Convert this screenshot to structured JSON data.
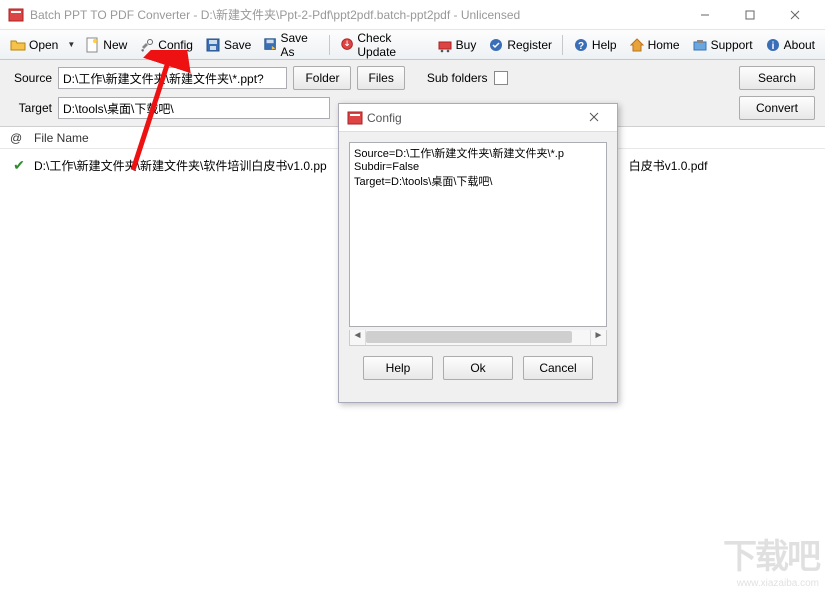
{
  "window": {
    "title": "Batch PPT TO PDF Converter - D:\\新建文件夹\\Ppt-2-Pdf\\ppt2pdf.batch-ppt2pdf - Unlicensed"
  },
  "toolbar": {
    "open": "Open",
    "new": "New",
    "config": "Config",
    "save": "Save",
    "save_as": "Save As",
    "check_update": "Check Update",
    "buy": "Buy",
    "register": "Register",
    "help": "Help",
    "home": "Home",
    "support": "Support",
    "about": "About"
  },
  "path": {
    "source_label": "Source",
    "source_value": "D:\\工作\\新建文件夹\\新建文件夹\\*.ppt?",
    "target_label": "Target",
    "target_value": "D:\\tools\\桌面\\下载吧\\",
    "folder_btn": "Folder",
    "files_btn": "Files",
    "subfolders_label": "Sub folders",
    "search_btn": "Search",
    "convert_btn": "Convert"
  },
  "list": {
    "col_at": "@",
    "col_file": "File Name",
    "rows": [
      {
        "left": "D:\\工作\\新建文件夹\\新建文件夹\\软件培训白皮书v1.0.pp",
        "right": "白皮书v1.0.pdf"
      }
    ]
  },
  "dialog": {
    "title": "Config",
    "content": "Source=D:\\工作\\新建文件夹\\新建文件夹\\*.p\nSubdir=False\nTarget=D:\\tools\\桌面\\下载吧\\",
    "help": "Help",
    "ok": "Ok",
    "cancel": "Cancel"
  },
  "watermark": {
    "big": "下载吧",
    "small": "www.xiazaiba.com"
  }
}
